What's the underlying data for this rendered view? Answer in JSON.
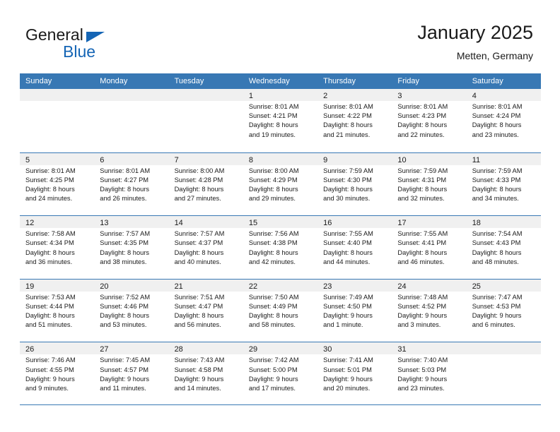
{
  "brand": {
    "name_part1": "General",
    "name_part2": "Blue",
    "logo_icon": "triangle-logo-icon",
    "accent_color": "#1565b5"
  },
  "header": {
    "title": "January 2025",
    "subtitle": "Metten, Germany"
  },
  "calendar": {
    "header_background": "#3878b4",
    "day_band_background": "#f0f0f0",
    "weekdays": [
      "Sunday",
      "Monday",
      "Tuesday",
      "Wednesday",
      "Thursday",
      "Friday",
      "Saturday"
    ],
    "weeks": [
      [
        {
          "empty": true
        },
        {
          "empty": true
        },
        {
          "empty": true
        },
        {
          "day": "1",
          "sunrise": "Sunrise: 8:01 AM",
          "sunset": "Sunset: 4:21 PM",
          "daylight1": "Daylight: 8 hours",
          "daylight2": "and 19 minutes."
        },
        {
          "day": "2",
          "sunrise": "Sunrise: 8:01 AM",
          "sunset": "Sunset: 4:22 PM",
          "daylight1": "Daylight: 8 hours",
          "daylight2": "and 21 minutes."
        },
        {
          "day": "3",
          "sunrise": "Sunrise: 8:01 AM",
          "sunset": "Sunset: 4:23 PM",
          "daylight1": "Daylight: 8 hours",
          "daylight2": "and 22 minutes."
        },
        {
          "day": "4",
          "sunrise": "Sunrise: 8:01 AM",
          "sunset": "Sunset: 4:24 PM",
          "daylight1": "Daylight: 8 hours",
          "daylight2": "and 23 minutes."
        }
      ],
      [
        {
          "day": "5",
          "sunrise": "Sunrise: 8:01 AM",
          "sunset": "Sunset: 4:25 PM",
          "daylight1": "Daylight: 8 hours",
          "daylight2": "and 24 minutes."
        },
        {
          "day": "6",
          "sunrise": "Sunrise: 8:01 AM",
          "sunset": "Sunset: 4:27 PM",
          "daylight1": "Daylight: 8 hours",
          "daylight2": "and 26 minutes."
        },
        {
          "day": "7",
          "sunrise": "Sunrise: 8:00 AM",
          "sunset": "Sunset: 4:28 PM",
          "daylight1": "Daylight: 8 hours",
          "daylight2": "and 27 minutes."
        },
        {
          "day": "8",
          "sunrise": "Sunrise: 8:00 AM",
          "sunset": "Sunset: 4:29 PM",
          "daylight1": "Daylight: 8 hours",
          "daylight2": "and 29 minutes."
        },
        {
          "day": "9",
          "sunrise": "Sunrise: 7:59 AM",
          "sunset": "Sunset: 4:30 PM",
          "daylight1": "Daylight: 8 hours",
          "daylight2": "and 30 minutes."
        },
        {
          "day": "10",
          "sunrise": "Sunrise: 7:59 AM",
          "sunset": "Sunset: 4:31 PM",
          "daylight1": "Daylight: 8 hours",
          "daylight2": "and 32 minutes."
        },
        {
          "day": "11",
          "sunrise": "Sunrise: 7:59 AM",
          "sunset": "Sunset: 4:33 PM",
          "daylight1": "Daylight: 8 hours",
          "daylight2": "and 34 minutes."
        }
      ],
      [
        {
          "day": "12",
          "sunrise": "Sunrise: 7:58 AM",
          "sunset": "Sunset: 4:34 PM",
          "daylight1": "Daylight: 8 hours",
          "daylight2": "and 36 minutes."
        },
        {
          "day": "13",
          "sunrise": "Sunrise: 7:57 AM",
          "sunset": "Sunset: 4:35 PM",
          "daylight1": "Daylight: 8 hours",
          "daylight2": "and 38 minutes."
        },
        {
          "day": "14",
          "sunrise": "Sunrise: 7:57 AM",
          "sunset": "Sunset: 4:37 PM",
          "daylight1": "Daylight: 8 hours",
          "daylight2": "and 40 minutes."
        },
        {
          "day": "15",
          "sunrise": "Sunrise: 7:56 AM",
          "sunset": "Sunset: 4:38 PM",
          "daylight1": "Daylight: 8 hours",
          "daylight2": "and 42 minutes."
        },
        {
          "day": "16",
          "sunrise": "Sunrise: 7:55 AM",
          "sunset": "Sunset: 4:40 PM",
          "daylight1": "Daylight: 8 hours",
          "daylight2": "and 44 minutes."
        },
        {
          "day": "17",
          "sunrise": "Sunrise: 7:55 AM",
          "sunset": "Sunset: 4:41 PM",
          "daylight1": "Daylight: 8 hours",
          "daylight2": "and 46 minutes."
        },
        {
          "day": "18",
          "sunrise": "Sunrise: 7:54 AM",
          "sunset": "Sunset: 4:43 PM",
          "daylight1": "Daylight: 8 hours",
          "daylight2": "and 48 minutes."
        }
      ],
      [
        {
          "day": "19",
          "sunrise": "Sunrise: 7:53 AM",
          "sunset": "Sunset: 4:44 PM",
          "daylight1": "Daylight: 8 hours",
          "daylight2": "and 51 minutes."
        },
        {
          "day": "20",
          "sunrise": "Sunrise: 7:52 AM",
          "sunset": "Sunset: 4:46 PM",
          "daylight1": "Daylight: 8 hours",
          "daylight2": "and 53 minutes."
        },
        {
          "day": "21",
          "sunrise": "Sunrise: 7:51 AM",
          "sunset": "Sunset: 4:47 PM",
          "daylight1": "Daylight: 8 hours",
          "daylight2": "and 56 minutes."
        },
        {
          "day": "22",
          "sunrise": "Sunrise: 7:50 AM",
          "sunset": "Sunset: 4:49 PM",
          "daylight1": "Daylight: 8 hours",
          "daylight2": "and 58 minutes."
        },
        {
          "day": "23",
          "sunrise": "Sunrise: 7:49 AM",
          "sunset": "Sunset: 4:50 PM",
          "daylight1": "Daylight: 9 hours",
          "daylight2": "and 1 minute."
        },
        {
          "day": "24",
          "sunrise": "Sunrise: 7:48 AM",
          "sunset": "Sunset: 4:52 PM",
          "daylight1": "Daylight: 9 hours",
          "daylight2": "and 3 minutes."
        },
        {
          "day": "25",
          "sunrise": "Sunrise: 7:47 AM",
          "sunset": "Sunset: 4:53 PM",
          "daylight1": "Daylight: 9 hours",
          "daylight2": "and 6 minutes."
        }
      ],
      [
        {
          "day": "26",
          "sunrise": "Sunrise: 7:46 AM",
          "sunset": "Sunset: 4:55 PM",
          "daylight1": "Daylight: 9 hours",
          "daylight2": "and 9 minutes."
        },
        {
          "day": "27",
          "sunrise": "Sunrise: 7:45 AM",
          "sunset": "Sunset: 4:57 PM",
          "daylight1": "Daylight: 9 hours",
          "daylight2": "and 11 minutes."
        },
        {
          "day": "28",
          "sunrise": "Sunrise: 7:43 AM",
          "sunset": "Sunset: 4:58 PM",
          "daylight1": "Daylight: 9 hours",
          "daylight2": "and 14 minutes."
        },
        {
          "day": "29",
          "sunrise": "Sunrise: 7:42 AM",
          "sunset": "Sunset: 5:00 PM",
          "daylight1": "Daylight: 9 hours",
          "daylight2": "and 17 minutes."
        },
        {
          "day": "30",
          "sunrise": "Sunrise: 7:41 AM",
          "sunset": "Sunset: 5:01 PM",
          "daylight1": "Daylight: 9 hours",
          "daylight2": "and 20 minutes."
        },
        {
          "day": "31",
          "sunrise": "Sunrise: 7:40 AM",
          "sunset": "Sunset: 5:03 PM",
          "daylight1": "Daylight: 9 hours",
          "daylight2": "and 23 minutes."
        },
        {
          "empty": true
        }
      ]
    ]
  }
}
